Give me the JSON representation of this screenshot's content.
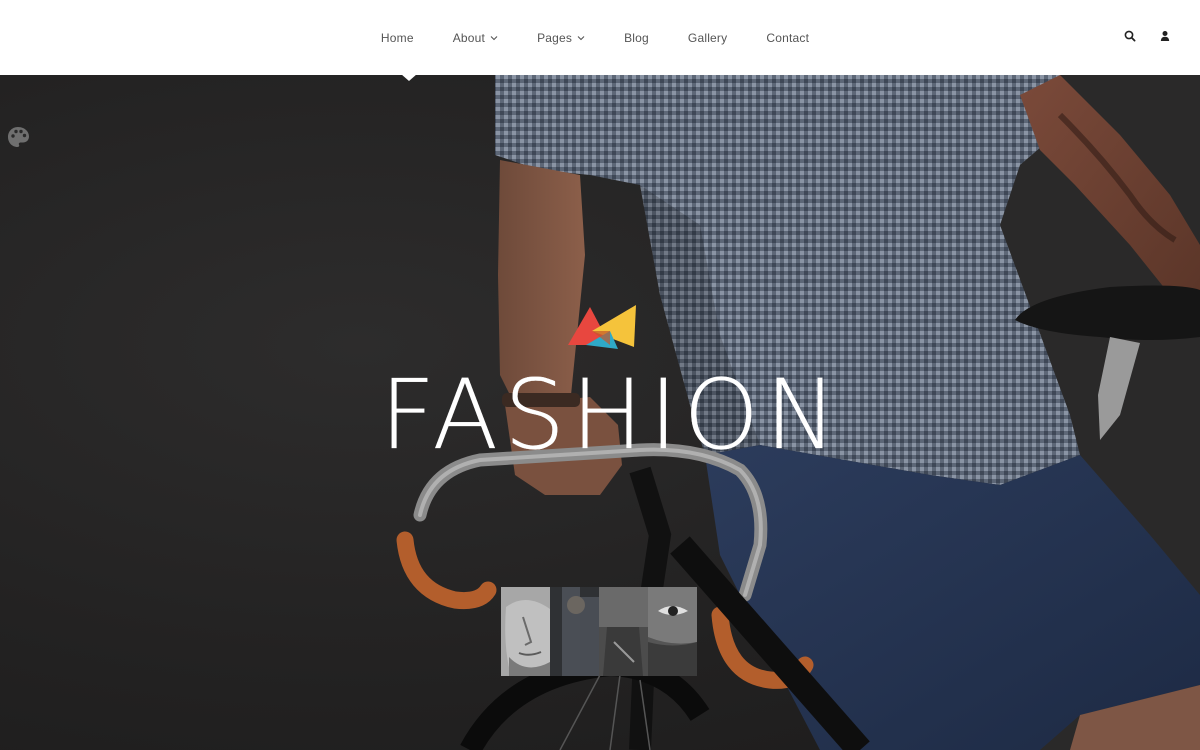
{
  "nav": {
    "items": [
      {
        "label": "Home",
        "has_dropdown": false,
        "active": true
      },
      {
        "label": "About",
        "has_dropdown": true,
        "active": false
      },
      {
        "label": "Pages",
        "has_dropdown": true,
        "active": false
      },
      {
        "label": "Blog",
        "has_dropdown": false,
        "active": false
      },
      {
        "label": "Gallery",
        "has_dropdown": false,
        "active": false
      },
      {
        "label": "Contact",
        "has_dropdown": false,
        "active": false
      }
    ],
    "icons": [
      "search-icon",
      "user-icon"
    ]
  },
  "hero": {
    "title": "FASHION",
    "logo_colors": [
      "#e8473f",
      "#f5c33b",
      "#2fa9c7"
    ],
    "side_icon": "palette-icon",
    "thumbnails": [
      "face-thumbnail",
      "portrait-thumbnail",
      "bike-thumbnail",
      "eye-thumbnail"
    ]
  },
  "colors": {
    "header_bg": "#ffffff",
    "nav_text": "#555555",
    "hero_bg": "#232222",
    "title": "#ffffff"
  }
}
